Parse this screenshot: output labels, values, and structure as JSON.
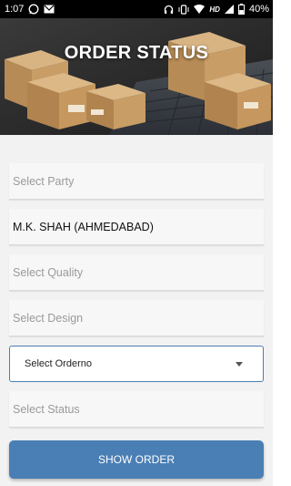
{
  "status_bar": {
    "time": "1:07",
    "network": "HD",
    "battery_percent": "40%"
  },
  "header": {
    "title": "ORDER STATUS"
  },
  "form": {
    "party_placeholder": "Select Party",
    "party_value": "M.K. SHAH (AHMEDABAD)",
    "quality_placeholder": "Select Quality",
    "design_placeholder": "Select Design",
    "orderno_selected": "Select Orderno",
    "status_placeholder": "Select Status"
  },
  "actions": {
    "show_order_label": "SHOW ORDER"
  },
  "colors": {
    "accent": "#4a7fb5",
    "status_bar": "#000000",
    "form_bg": "#f2f2f2"
  }
}
